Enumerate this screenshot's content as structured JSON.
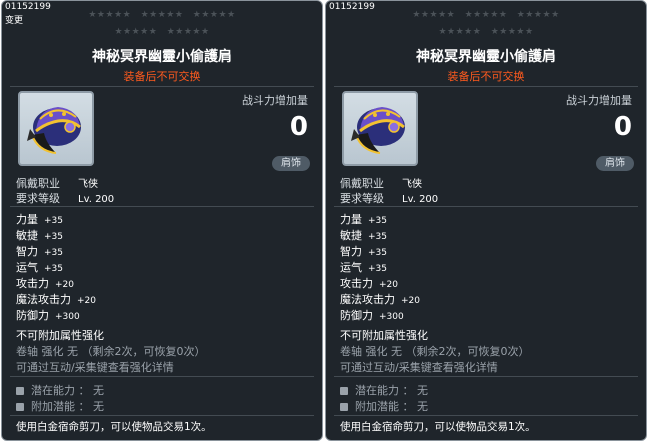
{
  "panels": [
    {
      "item_id": "01152199",
      "note": "变更",
      "stars_row1": [
        "★★★★★",
        "★★★★★",
        "★★★★★"
      ],
      "stars_row2": [
        "★★★★★",
        "★★★★★"
      ],
      "item_name": "神秘冥界幽靈小偷護肩",
      "untradable": "装备后不可交换",
      "combat_power_label": "战斗力增加量",
      "combat_power_value": "0",
      "category": "肩饰",
      "req_job_label": "佩戴职业",
      "req_job_value": "飞侠",
      "req_level_label": "要求等级",
      "req_level_value": "Lv. 200",
      "stats": [
        {
          "label": "力量",
          "value": "+35"
        },
        {
          "label": "敏捷",
          "value": "+35"
        },
        {
          "label": "智力",
          "value": "+35"
        },
        {
          "label": "运气",
          "value": "+35"
        },
        {
          "label": "攻击力",
          "value": "+20"
        },
        {
          "label": "魔法攻击力",
          "value": "+20"
        },
        {
          "label": "防御力",
          "value": "+300"
        }
      ],
      "unenhanceable": "不可附加属性强化",
      "scroll_info": "卷轴 强化 无 （剩余2次，可恢复0次）",
      "enhance_hint": "可通过互动/采集键查看强化详情",
      "potential": "潜在能力 ： 无",
      "additional_potential": "附加潜能 ： 无",
      "footer": "使用白金宿命剪刀，可以使物品交易1次。"
    },
    {
      "item_id": "01152199",
      "note": "",
      "stars_row1": [
        "★★★★★",
        "★★★★★",
        "★★★★★"
      ],
      "stars_row2": [
        "★★★★★",
        "★★★★★"
      ],
      "item_name": "神秘冥界幽靈小偷護肩",
      "untradable": "装备后不可交换",
      "combat_power_label": "战斗力增加量",
      "combat_power_value": "0",
      "category": "肩饰",
      "req_job_label": "佩戴职业",
      "req_job_value": "飞侠",
      "req_level_label": "要求等级",
      "req_level_value": "Lv. 200",
      "stats": [
        {
          "label": "力量",
          "value": "+35"
        },
        {
          "label": "敏捷",
          "value": "+35"
        },
        {
          "label": "智力",
          "value": "+35"
        },
        {
          "label": "运气",
          "value": "+35"
        },
        {
          "label": "攻击力",
          "value": "+20"
        },
        {
          "label": "魔法攻击力",
          "value": "+20"
        },
        {
          "label": "防御力",
          "value": "+300"
        }
      ],
      "unenhanceable": "不可附加属性强化",
      "scroll_info": "卷轴 强化 无 （剩余2次，可恢复0次）",
      "enhance_hint": "可通过互动/采集键查看强化详情",
      "potential": "潜在能力 ： 无",
      "additional_potential": "附加潜能 ： 无",
      "footer": "使用白金宿命剪刀，可以使物品交易1次。"
    }
  ],
  "colors": {
    "panel_bg": "#1f252b",
    "untradable": "#ff5a1e",
    "star_inactive": "#4b5258",
    "grey_text": "#9aa2aa"
  },
  "icons": [
    "shoulder-armor-icon",
    "square-bullet-icon"
  ]
}
